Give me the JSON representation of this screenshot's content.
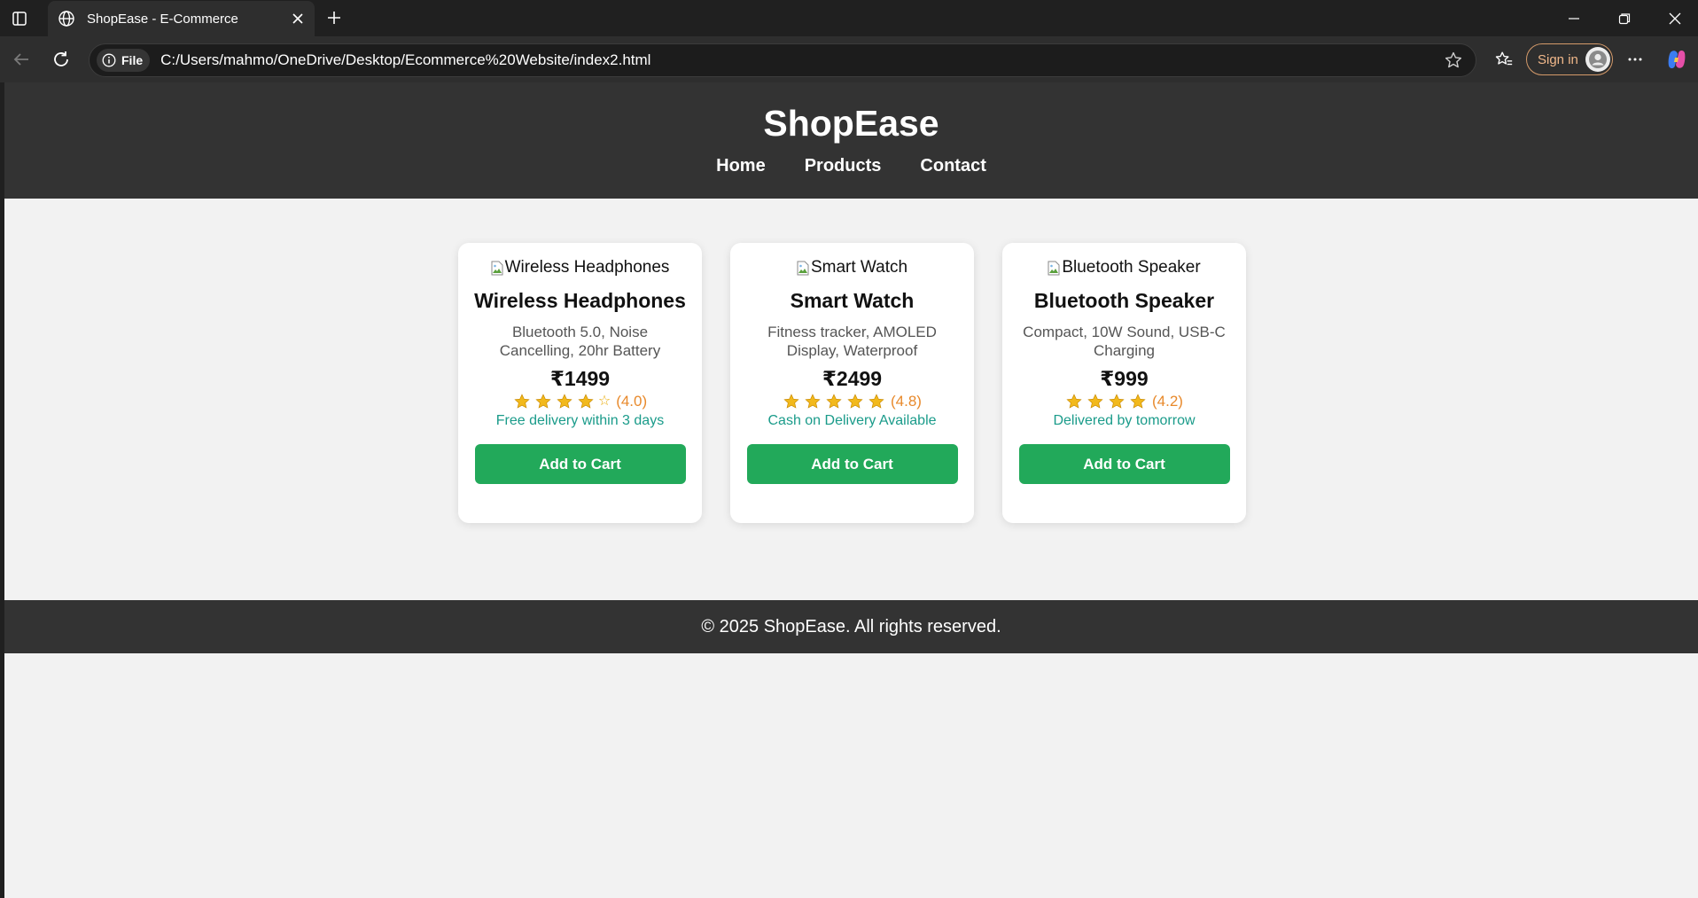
{
  "browser": {
    "tab_title": "ShopEase - E-Commerce",
    "file_chip": "File",
    "url": "C:/Users/mahmo/OneDrive/Desktop/Ecommerce%20Website/index2.html",
    "signin_label": "Sign in"
  },
  "site": {
    "title": "ShopEase",
    "nav": [
      "Home",
      "Products",
      "Contact"
    ],
    "footer": "© 2025 ShopEase. All rights reserved."
  },
  "products": [
    {
      "image_alt": "Wireless Headphones",
      "name": "Wireless Headphones",
      "description": "Bluetooth 5.0, Noise Cancelling, 20hr Battery",
      "price": "₹1499",
      "stars_filled": 4,
      "stars_hollow": 1,
      "rating_text": "(4.0)",
      "delivery": "Free delivery within 3 days",
      "button": "Add to Cart"
    },
    {
      "image_alt": "Smart Watch",
      "name": "Smart Watch",
      "description": "Fitness tracker, AMOLED Display, Waterproof",
      "price": "₹2499",
      "stars_filled": 5,
      "stars_hollow": 0,
      "rating_text": "(4.8)",
      "delivery": "Cash on Delivery Available",
      "button": "Add to Cart"
    },
    {
      "image_alt": "Bluetooth Speaker",
      "name": "Bluetooth Speaker",
      "description": "Compact, 10W Sound, USB-C Charging",
      "price": "₹999",
      "stars_filled": 4,
      "stars_hollow": 0,
      "rating_text": "(4.2)",
      "delivery": "Delivered by tomorrow",
      "button": "Add to Cart"
    }
  ],
  "colors": {
    "header_bg": "#333333",
    "page_bg": "#f2f2f2",
    "button_green": "#22a95a",
    "rating_orange": "#e8892b",
    "delivery_teal": "#1a9b8a",
    "star_gold": "#f2b91c"
  }
}
